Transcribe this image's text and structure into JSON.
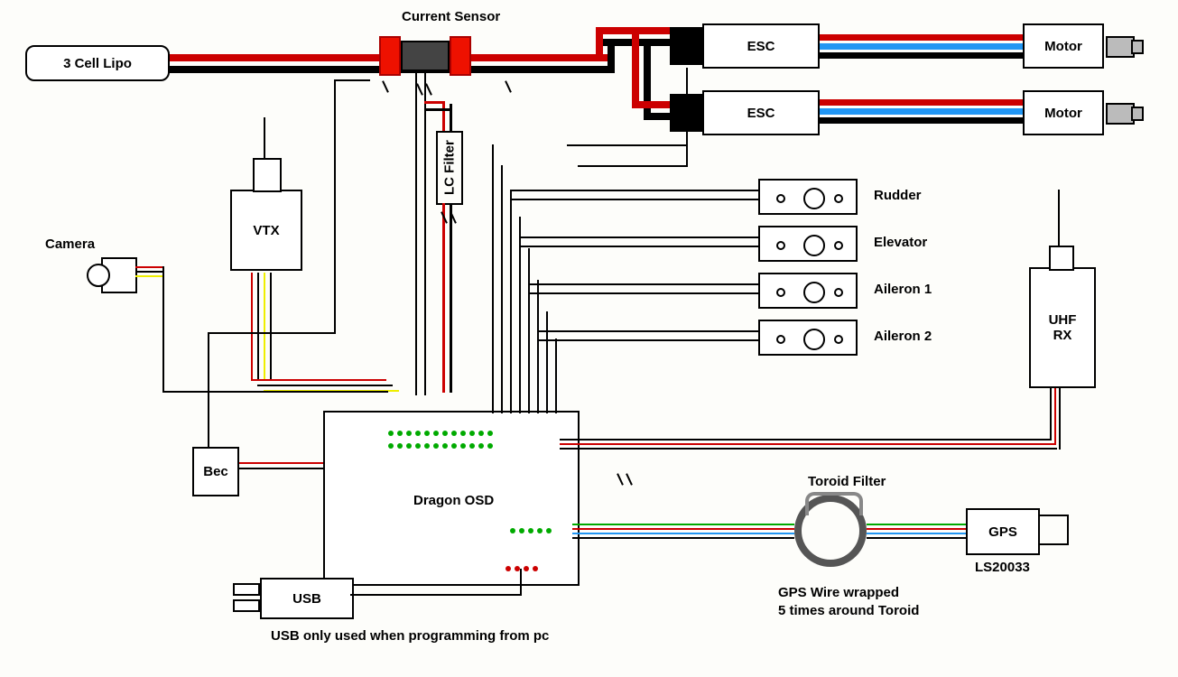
{
  "colors": {
    "wire_red": "#cc0000",
    "wire_black": "#000000",
    "wire_blue": "#2196f3",
    "wire_green": "#00aa00",
    "wire_yellow": "#eeee00"
  },
  "labels": {
    "lipo": "3 Cell Lipo",
    "current_sensor": "Current Sensor",
    "esc1": "ESC",
    "esc2": "ESC",
    "motor1": "Motor",
    "motor2": "Motor",
    "camera": "Camera",
    "vtx": "VTX",
    "lc_filter": "LC Filter",
    "bec": "Bec",
    "dragon_osd": "Dragon OSD",
    "usb": "USB",
    "usb_note": "USB only used when programming from pc",
    "toroid": "Toroid Filter",
    "toroid_note_l1": "GPS Wire wrapped",
    "toroid_note_l2": "5 times around Toroid",
    "gps": "GPS",
    "gps_model": "LS20033",
    "uhf_rx_l1": "UHF",
    "uhf_rx_l2": "RX"
  },
  "servos": [
    {
      "name": "Rudder"
    },
    {
      "name": "Elevator"
    },
    {
      "name": "Aileron 1"
    },
    {
      "name": "Aileron 2"
    }
  ]
}
